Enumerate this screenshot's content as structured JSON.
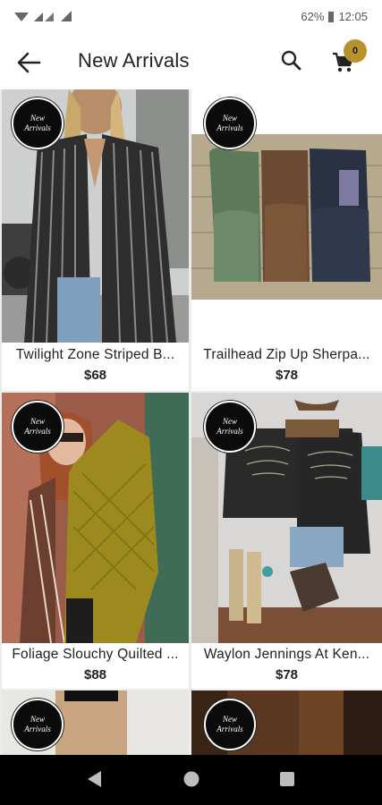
{
  "status_bar": {
    "battery": "62%",
    "time": "12:05"
  },
  "app_bar": {
    "title": "New Arrivals",
    "cart_count": "0",
    "icons": [
      "back-arrow-icon",
      "search-icon",
      "cart-icon"
    ]
  },
  "colors": {
    "accent": "#b8932b",
    "badge_bg": "#0b0b0b",
    "nav_bar": "#000000"
  },
  "badge_label_line1": "New",
  "badge_label_line2": "Arrivals",
  "products": [
    {
      "name": "Twilight Zone Striped B...",
      "price": "$68"
    },
    {
      "name": "Trailhead Zip Up Sherpa...",
      "price": "$78"
    },
    {
      "name": "Foliage Slouchy Quilted ...",
      "price": "$88"
    },
    {
      "name": "Waylon Jennings At Ken...",
      "price": "$78"
    },
    {
      "name": "",
      "price": ""
    },
    {
      "name": "",
      "price": ""
    }
  ]
}
